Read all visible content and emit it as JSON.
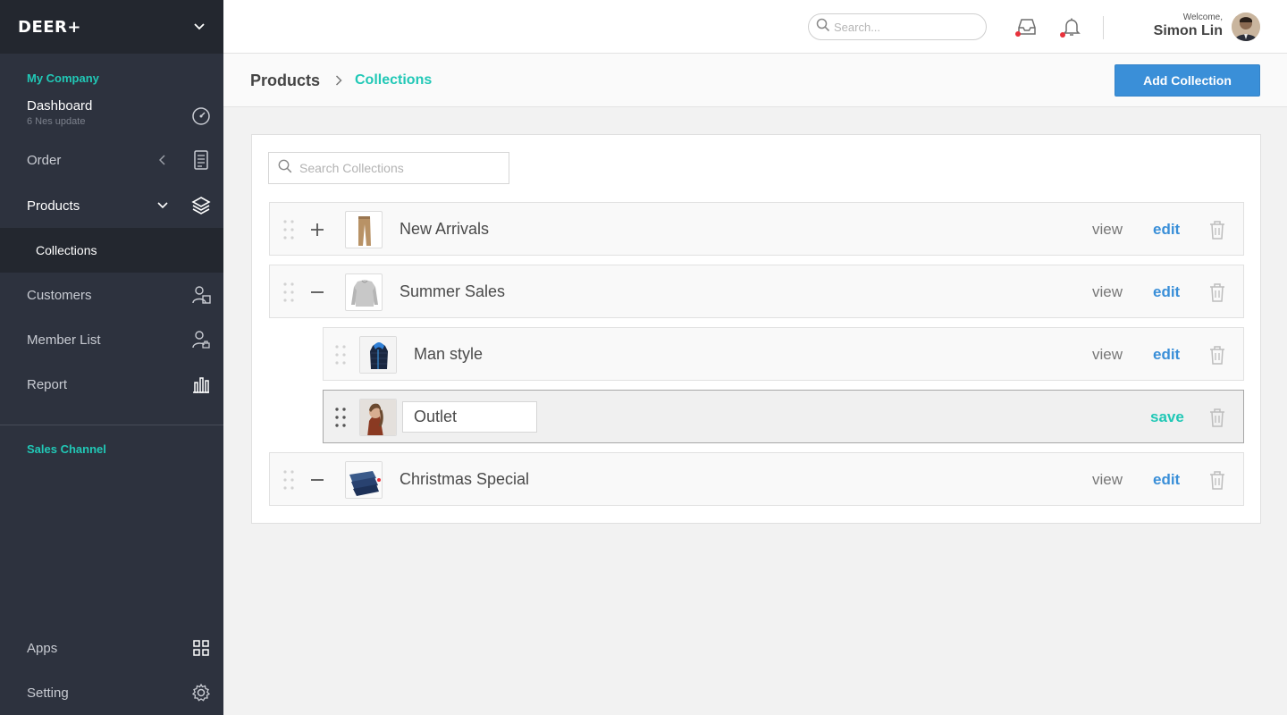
{
  "brand": {
    "name": "DEER+"
  },
  "sidebar": {
    "company_section": "My Company",
    "items": [
      {
        "label": "Dashboard",
        "sub": "6 Nes update",
        "icon": "dashboard-icon"
      },
      {
        "label": "Order",
        "icon": "order-icon"
      },
      {
        "label": "Products",
        "icon": "products-icon"
      },
      {
        "label": "Customers",
        "icon": "customers-icon"
      },
      {
        "label": "Member List",
        "icon": "member-icon"
      },
      {
        "label": "Report",
        "icon": "report-icon"
      },
      {
        "label": "Apps",
        "icon": "apps-icon"
      },
      {
        "label": "Setting",
        "icon": "gear-icon"
      }
    ],
    "sub_items": [
      {
        "label": "Collections"
      }
    ],
    "sales_section": "Sales Channel"
  },
  "topbar": {
    "search_placeholder": "Search...",
    "welcome": "Welcome,",
    "user_name": "Simon Lin"
  },
  "header": {
    "breadcrumb_parent": "Products",
    "breadcrumb_current": "Collections",
    "add_button": "Add Collection"
  },
  "collections": {
    "search_placeholder": "Search Collections",
    "view_label": "view",
    "edit_label": "edit",
    "save_label": "save",
    "rows": [
      {
        "name": "New Arrivals"
      },
      {
        "name": "Summer Sales"
      },
      {
        "name": "Man style"
      },
      {
        "name": "Outlet"
      },
      {
        "name": "Christmas Special"
      }
    ]
  },
  "colors": {
    "accent_teal": "#21c8b6",
    "accent_blue": "#3a8fd8",
    "sidebar_bg": "#2d323e"
  }
}
